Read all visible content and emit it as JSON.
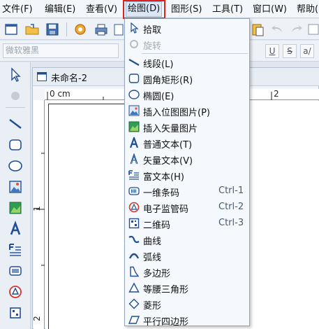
{
  "menubar": {
    "items": [
      "文件(F)",
      "编辑(E)",
      "查看(V)",
      "绘图(D)",
      "图形(S)",
      "工具(T)",
      "窗口(W)",
      "帮助("
    ]
  },
  "toolbar2": {
    "font_name": "微软雅黑",
    "underline_label": "U",
    "strike_label": "S",
    "extra_label": "a/"
  },
  "document": {
    "tab_title": "未命名-2",
    "ruler_h_labels": [
      "0 cm",
      "1",
      "2"
    ],
    "ruler_v_labels": [
      "1",
      "2"
    ]
  },
  "draw_menu": {
    "items": [
      {
        "label": "拾取",
        "shortcut": "",
        "icon": "cursor-arrow-icon",
        "disabled": false
      },
      {
        "label": "旋转",
        "shortcut": "",
        "icon": "rotate-icon",
        "disabled": true
      },
      {
        "label": "线段(L)",
        "shortcut": "",
        "icon": "line-segment-icon",
        "disabled": false
      },
      {
        "label": "圆角矩形(R)",
        "shortcut": "",
        "icon": "rounded-rectangle-icon",
        "disabled": false
      },
      {
        "label": "椭圆(E)",
        "shortcut": "",
        "icon": "ellipse-icon",
        "disabled": false
      },
      {
        "label": "插入位图图片(P)",
        "shortcut": "",
        "icon": "bitmap-image-icon",
        "disabled": false
      },
      {
        "label": "插入矢量图片",
        "shortcut": "",
        "icon": "vector-image-icon",
        "disabled": false
      },
      {
        "label": "普通文本(T)",
        "shortcut": "",
        "icon": "text-icon",
        "disabled": false
      },
      {
        "label": "矢量文本(V)",
        "shortcut": "",
        "icon": "vector-text-icon",
        "disabled": false
      },
      {
        "label": "富文本(H)",
        "shortcut": "",
        "icon": "rich-text-icon",
        "disabled": false
      },
      {
        "label": "一维条码",
        "shortcut": "Ctrl-1",
        "icon": "barcode-icon",
        "disabled": false
      },
      {
        "label": "电子监管码",
        "shortcut": "Ctrl-2",
        "icon": "supervision-code-icon",
        "disabled": false
      },
      {
        "label": "二维码",
        "shortcut": "Ctrl-3",
        "icon": "qr-code-icon",
        "disabled": false
      },
      {
        "label": "曲线",
        "shortcut": "",
        "icon": "curve-icon",
        "disabled": false
      },
      {
        "label": "弧线",
        "shortcut": "",
        "icon": "arc-icon",
        "disabled": false
      },
      {
        "label": "多边形",
        "shortcut": "",
        "icon": "polygon-icon",
        "disabled": false
      },
      {
        "label": "等腰三角形",
        "shortcut": "",
        "icon": "triangle-icon",
        "disabled": false
      },
      {
        "label": "菱形",
        "shortcut": "",
        "icon": "diamond-icon",
        "disabled": false
      },
      {
        "label": "平行四边形",
        "shortcut": "",
        "icon": "parallelogram-icon",
        "disabled": false
      }
    ]
  },
  "colors": {
    "highlight_box": "#e0201c",
    "menu_bg": "#f5f8fc",
    "accent_blue": "#1f4e96"
  }
}
